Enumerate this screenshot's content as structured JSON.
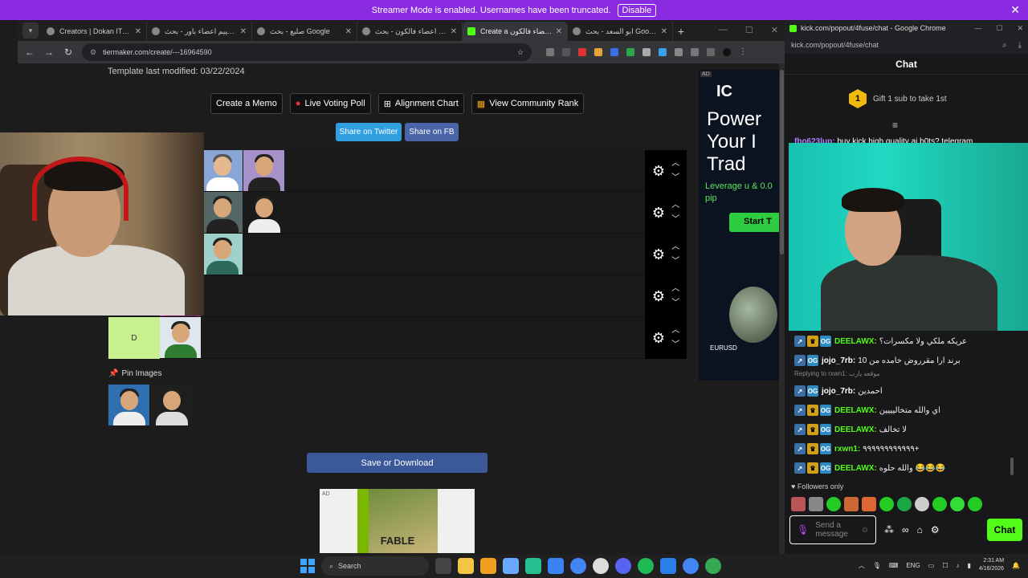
{
  "streamer_bar": {
    "message": "Streamer Mode is enabled. Usernames have been truncated.",
    "disable_label": "Disable"
  },
  "left_window": {
    "tabs": [
      {
        "title": "Creators | Dokan IT LLC",
        "active": false
      },
      {
        "title": "تقييم اعضاء باور - بحث Google",
        "active": false
      },
      {
        "title": "صليع - بحث Google",
        "active": false
      },
      {
        "title": "تقييم اعضاء فالكون - بحث",
        "active": false
      },
      {
        "title": "Create a تقييم اعضاء فالكون",
        "active": true
      },
      {
        "title": "ابو السعد - بحث Google",
        "active": false
      }
    ],
    "url": "tiermaker.com/create/---16964590",
    "template_modified": "Template last modified: 03/22/2024",
    "buttons": {
      "meme": "Create a Memo",
      "poll": "Live Voting Poll",
      "alignment": "Alignment Chart",
      "community": "View Community Rank"
    },
    "share_twitter": "Share on Twitter",
    "share_fb": "Share on FB",
    "tiers": [
      {
        "label": "",
        "items": 3
      },
      {
        "label": "",
        "items": 3
      },
      {
        "label": "",
        "items": 2
      },
      {
        "label": "",
        "items": 1
      },
      {
        "label": "D",
        "items": 1
      }
    ],
    "pin_title": "Pin Images",
    "save_label": "Save or Download",
    "ad": {
      "tag": "AD",
      "game_title": "FABLE",
      "side_brand": "IC",
      "side_headline": "Power Your I Trad",
      "side_sub": "Leverage u & 0.0 pip",
      "side_button": "Start T",
      "side_ticker": "EURUSD"
    }
  },
  "chat_window": {
    "title": "kick.com/popout/4fuse/chat - Google Chrome",
    "url": "kick.com/popout/4fuse/chat",
    "header": "Chat",
    "gift_rank": "1",
    "gift_text": "Gift 1 sub to take 1st",
    "cut_message": {
      "user": "fbo623lup:",
      "text": " buy kick high quality ai b0ts? telegram"
    },
    "messages": [
      {
        "user": "DEELAWX:",
        "text": "عريكه ملكي ولا مكسرات؟",
        "color": "#53fc18",
        "crown": true
      },
      {
        "user": "jojo_7rb:",
        "text": "10 برند ارا مقرروض خامده من",
        "color": "#ffffff",
        "crown": false
      },
      {
        "reply": "Replying to rxwn1: موقعه يارب"
      },
      {
        "user": "jojo_7rb:",
        "text": "احمدين",
        "color": "#ffffff",
        "crown": false
      },
      {
        "user": "DEELAWX:",
        "text": "اي والله متخاليييين",
        "color": "#53fc18",
        "crown": true
      },
      {
        "user": "DEELAWX:",
        "text": "لا تخالف",
        "color": "#53fc18",
        "crown": true
      },
      {
        "user": "rxwn1:",
        "text": "٩٩٩٩٩٩٩٩٩٩٩٩+",
        "color": "#53fc18",
        "crown": true
      },
      {
        "user": "DEELAWX:",
        "text": "والله حلوه 😂😂😂",
        "color": "#53fc18",
        "crown": true
      }
    ],
    "followers_only": "Followers only",
    "input_placeholder": "Send a message",
    "send_label": "Chat"
  },
  "taskbar": {
    "search_placeholder": "Search",
    "lang": "ENG",
    "time": "2:31 AM",
    "date": "4/16/2026"
  },
  "colors": {
    "kick_green": "#53fc18",
    "streamer_purple": "#8a2be2",
    "tier_d": "#c8f08f"
  }
}
